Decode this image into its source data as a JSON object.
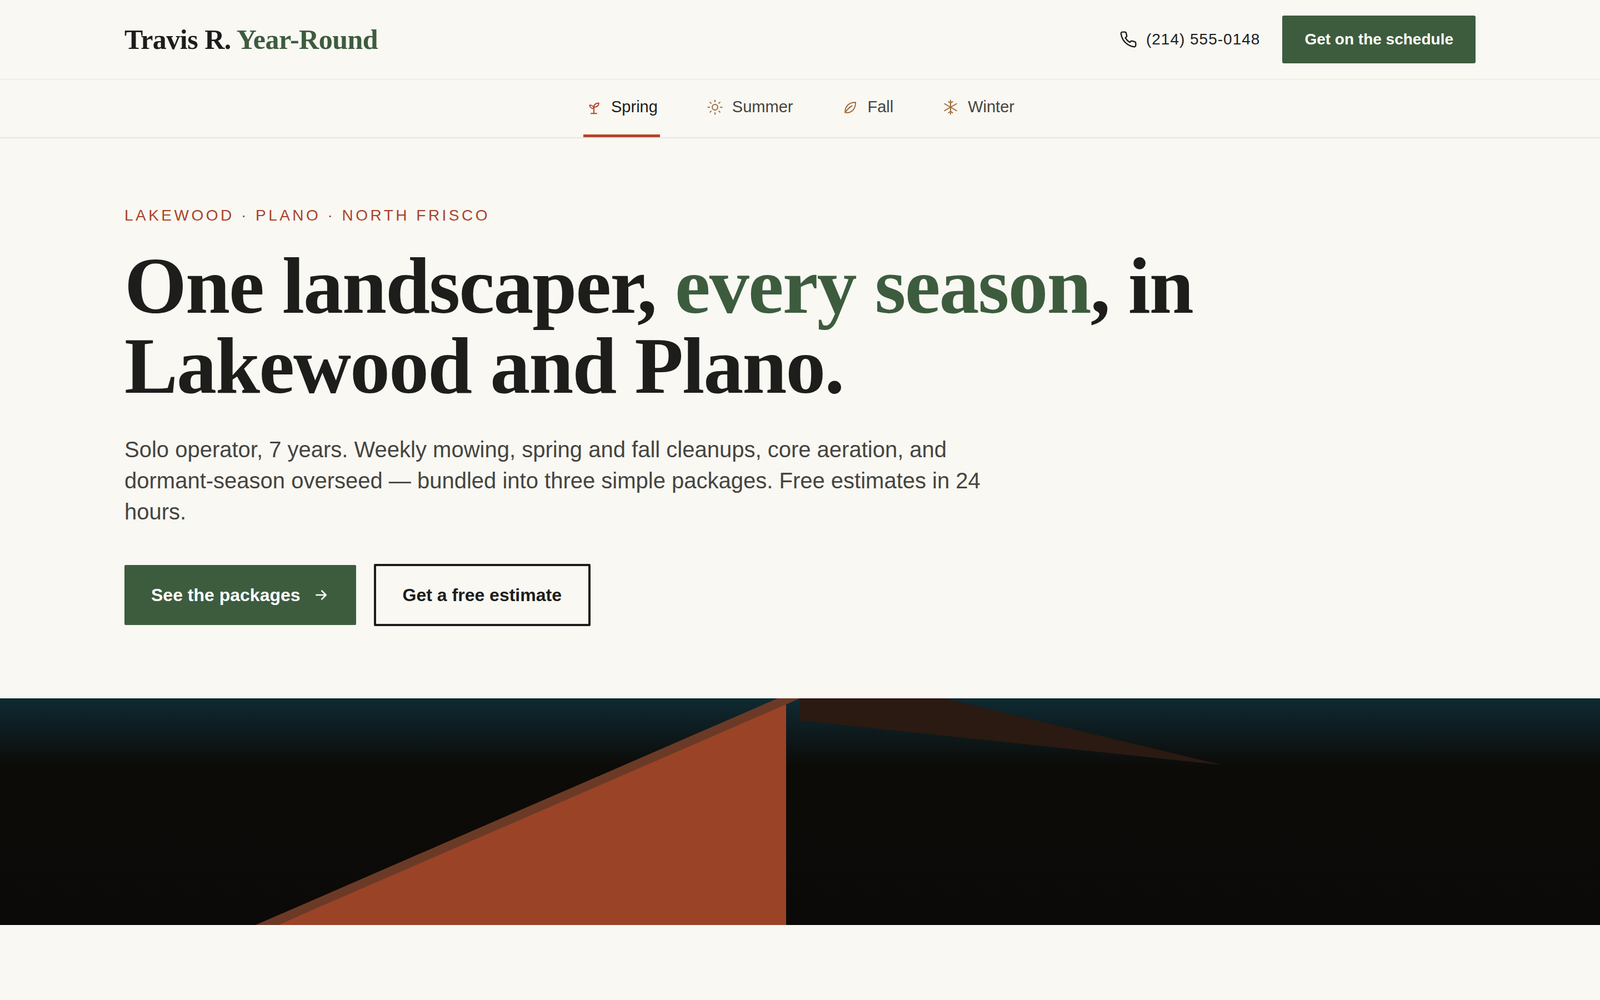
{
  "header": {
    "logo": {
      "name": "Travis R.",
      "accent": "Year-Round"
    },
    "phone": "(214) 555-0148",
    "cta": "Get on the schedule"
  },
  "tabs": [
    {
      "label": "Spring",
      "selected": true,
      "kind": "spring"
    },
    {
      "label": "Summer",
      "selected": false,
      "kind": "summer"
    },
    {
      "label": "Fall",
      "selected": false,
      "kind": "fall"
    },
    {
      "label": "Winter",
      "selected": false,
      "kind": "winter"
    }
  ],
  "hero": {
    "eyebrow": "LAKEWOOD · PLANO · NORTH FRISCO",
    "heading": [
      {
        "text": "One landscaper, ",
        "accent": false
      },
      {
        "text": "every season",
        "accent": true
      },
      {
        "text": ", in Lakewood and Plano.",
        "accent": false
      }
    ],
    "body": "Solo operator, 7 years. Weekly mowing, spring and fall cleanups, core aeration, and dormant-season overseed — bundled into three simple packages. Free estimates in 24 hours.",
    "primary_button": "See the packages",
    "secondary_button": "Get a free estimate"
  }
}
